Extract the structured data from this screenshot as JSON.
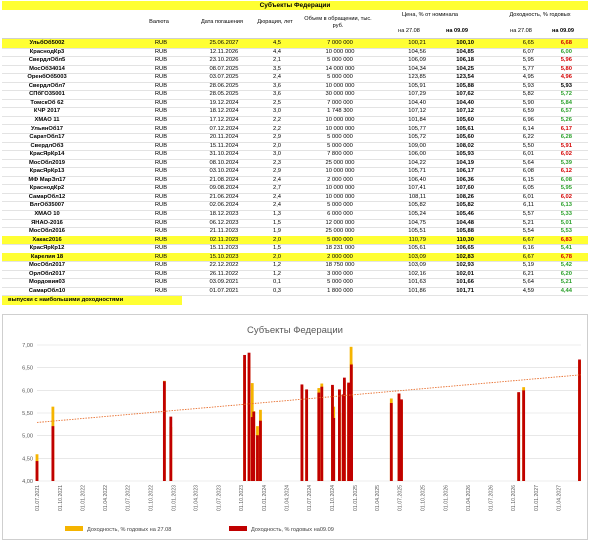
{
  "table": {
    "title": "Субъекты Федерации",
    "headers": {
      "currency": "Валюта",
      "maturity": "Дата погашения",
      "duration": "Дюрация, лет",
      "volume": "Объем в обращении, тыс. руб.",
      "price_group": "Цена, % от номинала",
      "price_d1": "на 27.08",
      "price_d2": "на 09.09",
      "yield_group": "Доходность, % годовых",
      "yield_d1": "на 27.08",
      "yield_d2": "на 09.09"
    },
    "rows": [
      {
        "name": "УльбОб5002",
        "currency": "RUB",
        "maturity": "25.06.2027",
        "duration": "4,5",
        "volume": "7 000 000",
        "price1": "100,21",
        "price2": "100,10",
        "yield1": "6,65",
        "yield2": "6,68",
        "dir": "up",
        "highlight": true
      },
      {
        "name": "КраснодКр3",
        "currency": "RUB",
        "maturity": "12.11.2026",
        "duration": "4,4",
        "volume": "10 000 000",
        "price1": "104,56",
        "price2": "104,85",
        "yield1": "6,07",
        "yield2": "6,00",
        "dir": "down",
        "highlight": false
      },
      {
        "name": "СвердлОбл5",
        "currency": "RUB",
        "maturity": "23.10.2026",
        "duration": "2,1",
        "volume": "5 000 000",
        "price1": "106,09",
        "price2": "106,18",
        "yield1": "5,95",
        "yield2": "5,96",
        "dir": "up",
        "highlight": false
      },
      {
        "name": "МосОб34014",
        "currency": "RUB",
        "maturity": "08.07.2025",
        "duration": "3,5",
        "volume": "14 000 000",
        "price1": "104,34",
        "price2": "104,25",
        "yield1": "5,77",
        "yield2": "5,80",
        "dir": "up",
        "highlight": false
      },
      {
        "name": "ОренбОб5003",
        "currency": "RUB",
        "maturity": "03.07.2025",
        "duration": "2,4",
        "volume": "5 000 000",
        "price1": "123,85",
        "price2": "123,54",
        "yield1": "4,95",
        "yield2": "4,96",
        "dir": "up",
        "highlight": false
      },
      {
        "name": "СвердлОбл7",
        "currency": "RUB",
        "maturity": "28.06.2025",
        "duration": "3,6",
        "volume": "10 000 000",
        "price1": "105,91",
        "price2": "105,88",
        "yield1": "5,93",
        "yield2": "5,93",
        "dir": "none",
        "highlight": false
      },
      {
        "name": "СПбГО35001",
        "currency": "RUB",
        "maturity": "28.05.2025",
        "duration": "3,6",
        "volume": "30 000 000",
        "price1": "107,29",
        "price2": "107,62",
        "yield1": "5,82",
        "yield2": "5,72",
        "dir": "down",
        "highlight": false
      },
      {
        "name": "ТомскОб 62",
        "currency": "RUB",
        "maturity": "19.12.2024",
        "duration": "2,5",
        "volume": "7 000 000",
        "price1": "104,40",
        "price2": "104,40",
        "yield1": "5,90",
        "yield2": "5,84",
        "dir": "down",
        "highlight": false
      },
      {
        "name": "КЧР 2017",
        "currency": "RUB",
        "maturity": "18.12.2024",
        "duration": "3,0",
        "volume": "1 748 300",
        "price1": "107,12",
        "price2": "107,12",
        "yield1": "6,59",
        "yield2": "6,57",
        "dir": "down",
        "highlight": false
      },
      {
        "name": "ХМАО 11",
        "currency": "RUB",
        "maturity": "17.12.2024",
        "duration": "2,2",
        "volume": "10 000 000",
        "price1": "101,84",
        "price2": "105,60",
        "yield1": "6,96",
        "yield2": "5,26",
        "dir": "down",
        "highlight": false
      },
      {
        "name": "УльянОб17",
        "currency": "RUB",
        "maturity": "07.12.2024",
        "duration": "2,2",
        "volume": "10 000 000",
        "price1": "105,77",
        "price2": "105,61",
        "yield1": "6,14",
        "yield2": "6,17",
        "dir": "up",
        "highlight": false
      },
      {
        "name": "СаратОбл17",
        "currency": "RUB",
        "maturity": "20.11.2024",
        "duration": "2,9",
        "volume": "5 000 000",
        "price1": "105,72",
        "price2": "105,60",
        "yield1": "6,22",
        "yield2": "6,28",
        "dir": "down",
        "highlight": false
      },
      {
        "name": "СвердлОб3",
        "currency": "RUB",
        "maturity": "15.11.2024",
        "duration": "2,0",
        "volume": "5 000 000",
        "price1": "109,00",
        "price2": "108,02",
        "yield1": "5,50",
        "yield2": "5,91",
        "dir": "up",
        "highlight": false
      },
      {
        "name": "КрасЯрКр14",
        "currency": "RUB",
        "maturity": "31.10.2024",
        "duration": "3,0",
        "volume": "7 800 000",
        "price1": "106,00",
        "price2": "105,93",
        "yield1": "6,01",
        "yield2": "6,02",
        "dir": "up",
        "highlight": false
      },
      {
        "name": "МосОбл2019",
        "currency": "RUB",
        "maturity": "08.10.2024",
        "duration": "2,3",
        "volume": "25 000 000",
        "price1": "104,22",
        "price2": "104,19",
        "yield1": "5,64",
        "yield2": "5,39",
        "dir": "down",
        "highlight": false
      },
      {
        "name": "КрасЯрКр13",
        "currency": "RUB",
        "maturity": "03.10.2024",
        "duration": "2,9",
        "volume": "10 000 000",
        "price1": "105,71",
        "price2": "106,17",
        "yield1": "6,08",
        "yield2": "6,12",
        "dir": "up",
        "highlight": false
      },
      {
        "name": "МФ МарЭл17",
        "currency": "RUB",
        "maturity": "21.08.2024",
        "duration": "2,4",
        "volume": "2 000 000",
        "price1": "106,40",
        "price2": "106,36",
        "yield1": "6,15",
        "yield2": "6,08",
        "dir": "down",
        "highlight": false
      },
      {
        "name": "КраснодКр2",
        "currency": "RUB",
        "maturity": "09.08.2024",
        "duration": "2,7",
        "volume": "10 000 000",
        "price1": "107,41",
        "price2": "107,60",
        "yield1": "6,05",
        "yield2": "5,95",
        "dir": "down",
        "highlight": false
      },
      {
        "name": "СамарОбл12",
        "currency": "RUB",
        "maturity": "21.06.2024",
        "duration": "2,4",
        "volume": "10 000 000",
        "price1": "108,11",
        "price2": "108,26",
        "yield1": "6,01",
        "yield2": "6,02",
        "dir": "up",
        "highlight": false
      },
      {
        "name": "ВлгОб35007",
        "currency": "RUB",
        "maturity": "02.06.2024",
        "duration": "2,4",
        "volume": "5 000 000",
        "price1": "105,82",
        "price2": "105,82",
        "yield1": "6,11",
        "yield2": "6,13",
        "dir": "down",
        "highlight": false
      },
      {
        "name": "ХМАО 10",
        "currency": "RUB",
        "maturity": "18.12.2023",
        "duration": "1,3",
        "volume": "6 000 000",
        "price1": "105,24",
        "price2": "105,46",
        "yield1": "5,57",
        "yield2": "5,33",
        "dir": "down",
        "highlight": false
      },
      {
        "name": "ЯНАО-2016",
        "currency": "RUB",
        "maturity": "06.12.2023",
        "duration": "1,5",
        "volume": "12 000 000",
        "price1": "104,75",
        "price2": "104,48",
        "yield1": "5,21",
        "yield2": "5,01",
        "dir": "down",
        "highlight": false
      },
      {
        "name": "МосОбл2016",
        "currency": "RUB",
        "maturity": "21.11.2023",
        "duration": "1,9",
        "volume": "25 000 000",
        "price1": "105,51",
        "price2": "105,88",
        "yield1": "5,54",
        "yield2": "5,53",
        "dir": "down",
        "highlight": false
      },
      {
        "name": "Хакас2016",
        "currency": "RUB",
        "maturity": "02.11.2023",
        "duration": "2,0",
        "volume": "5 000 000",
        "price1": "110,79",
        "price2": "110,30",
        "yield1": "6,67",
        "yield2": "6,83",
        "dir": "up",
        "highlight": true
      },
      {
        "name": "КрасЯрКр12",
        "currency": "RUB",
        "maturity": "15.11.2023",
        "duration": "1,5",
        "volume": "18 231 000",
        "price1": "105,61",
        "price2": "106,65",
        "yield1": "6,16",
        "yield2": "5,41",
        "dir": "down",
        "highlight": false
      },
      {
        "name": "Карелия 18",
        "currency": "RUB",
        "maturity": "15.10.2023",
        "duration": "2,0",
        "volume": "2 000 000",
        "price1": "103,09",
        "price2": "102,83",
        "yield1": "6,67",
        "yield2": "6,78",
        "dir": "up",
        "highlight": true
      },
      {
        "name": "МосОбл2017",
        "currency": "RUB",
        "maturity": "22.12.2022",
        "duration": "1,2",
        "volume": "18 750 000",
        "price1": "103,09",
        "price2": "102,93",
        "yield1": "5,19",
        "yield2": "5,42",
        "dir": "down",
        "highlight": false
      },
      {
        "name": "ОрлОбл2017",
        "currency": "RUB",
        "maturity": "26.11.2022",
        "duration": "1,2",
        "volume": "3 000 000",
        "price1": "102,16",
        "price2": "102,01",
        "yield1": "6,21",
        "yield2": "6,20",
        "dir": "down",
        "highlight": false
      },
      {
        "name": "Мордовия03",
        "currency": "RUB",
        "maturity": "03.09.2021",
        "duration": "0,1",
        "volume": "5 000 000",
        "price1": "101,63",
        "price2": "101,66",
        "yield1": "5,64",
        "yield2": "5,21",
        "dir": "down",
        "highlight": false
      },
      {
        "name": "СамарОбл10",
        "currency": "RUB",
        "maturity": "01.07.2021",
        "duration": "0,3",
        "volume": "1 800 000",
        "price1": "101,86",
        "price2": "101,71",
        "yield1": "4,59",
        "yield2": "4,44",
        "dir": "down",
        "highlight": false
      }
    ],
    "note": "выпуски с наибольшими доходностями"
  },
  "colors": {
    "highlight": "#ffff33",
    "series1": "#f5b400",
    "series2": "#c00000",
    "trend": "#e87030",
    "up": "#d40000",
    "down": "#2aa02a"
  },
  "chart_data": {
    "type": "bar",
    "title": "Субъекты Федерации",
    "xlabel": "",
    "ylabel": "",
    "ylim": [
      4.0,
      7.0
    ],
    "yticks": [
      "4,00",
      "4,50",
      "5,00",
      "5,50",
      "6,00",
      "6,50",
      "7,00"
    ],
    "xticks": [
      "01.07.2021",
      "01.10.2021",
      "01.01.2022",
      "01.04.2022",
      "01.07.2022",
      "01.10.2022",
      "01.01.2023",
      "01.04.2023",
      "01.07.2023",
      "01.10.2023",
      "01.01.2024",
      "01.04.2024",
      "01.07.2024",
      "01.10.2024",
      "01.01.2025",
      "01.04.2025",
      "01.07.2025",
      "01.10.2025",
      "01.01.2026",
      "01.04.2026",
      "01.07.2026",
      "01.10.2026",
      "01.01.2027",
      "01.04.2027"
    ],
    "legend_position": "bottom",
    "trendline": true,
    "series": [
      {
        "name": "Доходность, % годовых на 27.08",
        "points": [
          {
            "x": "2021-07-01",
            "y": 4.59
          },
          {
            "x": "2021-09-03",
            "y": 5.64
          },
          {
            "x": "2022-11-26",
            "y": 6.21
          },
          {
            "x": "2022-12-22",
            "y": 5.19
          },
          {
            "x": "2023-10-15",
            "y": 6.67
          },
          {
            "x": "2023-11-02",
            "y": 6.67
          },
          {
            "x": "2023-11-15",
            "y": 6.16
          },
          {
            "x": "2023-11-21",
            "y": 5.54
          },
          {
            "x": "2023-12-06",
            "y": 5.21
          },
          {
            "x": "2023-12-18",
            "y": 5.57
          },
          {
            "x": "2024-06-02",
            "y": 6.11
          },
          {
            "x": "2024-06-21",
            "y": 6.01
          },
          {
            "x": "2024-08-09",
            "y": 6.05
          },
          {
            "x": "2024-08-21",
            "y": 6.15
          },
          {
            "x": "2024-10-03",
            "y": 6.08
          },
          {
            "x": "2024-10-08",
            "y": 5.64
          },
          {
            "x": "2024-10-31",
            "y": 6.01
          },
          {
            "x": "2024-11-15",
            "y": 5.5
          },
          {
            "x": "2024-11-20",
            "y": 6.22
          },
          {
            "x": "2024-12-07",
            "y": 6.14
          },
          {
            "x": "2024-12-17",
            "y": 6.96
          },
          {
            "x": "2024-12-18",
            "y": 6.59
          },
          {
            "x": "2024-12-19",
            "y": 5.9
          },
          {
            "x": "2025-05-28",
            "y": 5.82
          },
          {
            "x": "2025-06-28",
            "y": 5.93
          },
          {
            "x": "2025-07-03",
            "y": 4.95
          },
          {
            "x": "2025-07-08",
            "y": 5.77
          },
          {
            "x": "2026-10-23",
            "y": 5.95
          },
          {
            "x": "2026-11-12",
            "y": 6.07
          },
          {
            "x": "2027-06-25",
            "y": 6.65
          }
        ]
      },
      {
        "name": "Доходность, % годовых на09.09",
        "points": [
          {
            "x": "2021-07-01",
            "y": 4.44
          },
          {
            "x": "2021-09-03",
            "y": 5.21
          },
          {
            "x": "2022-11-26",
            "y": 6.2
          },
          {
            "x": "2022-12-22",
            "y": 5.42
          },
          {
            "x": "2023-10-15",
            "y": 6.78
          },
          {
            "x": "2023-11-02",
            "y": 6.83
          },
          {
            "x": "2023-11-15",
            "y": 5.41
          },
          {
            "x": "2023-11-21",
            "y": 5.53
          },
          {
            "x": "2023-12-06",
            "y": 5.01
          },
          {
            "x": "2023-12-18",
            "y": 5.33
          },
          {
            "x": "2024-06-02",
            "y": 6.13
          },
          {
            "x": "2024-06-21",
            "y": 6.02
          },
          {
            "x": "2024-08-09",
            "y": 5.95
          },
          {
            "x": "2024-08-21",
            "y": 6.08
          },
          {
            "x": "2024-10-03",
            "y": 6.12
          },
          {
            "x": "2024-10-08",
            "y": 5.39
          },
          {
            "x": "2024-10-31",
            "y": 6.02
          },
          {
            "x": "2024-11-15",
            "y": 5.91
          },
          {
            "x": "2024-11-20",
            "y": 6.28
          },
          {
            "x": "2024-12-07",
            "y": 6.17
          },
          {
            "x": "2024-12-17",
            "y": 5.26
          },
          {
            "x": "2024-12-18",
            "y": 6.57
          },
          {
            "x": "2024-12-19",
            "y": 5.84
          },
          {
            "x": "2025-05-28",
            "y": 5.72
          },
          {
            "x": "2025-06-28",
            "y": 5.93
          },
          {
            "x": "2025-07-03",
            "y": 4.96
          },
          {
            "x": "2025-07-08",
            "y": 5.8
          },
          {
            "x": "2026-10-23",
            "y": 5.96
          },
          {
            "x": "2026-11-12",
            "y": 6.0
          },
          {
            "x": "2027-06-25",
            "y": 6.68
          }
        ]
      }
    ]
  }
}
